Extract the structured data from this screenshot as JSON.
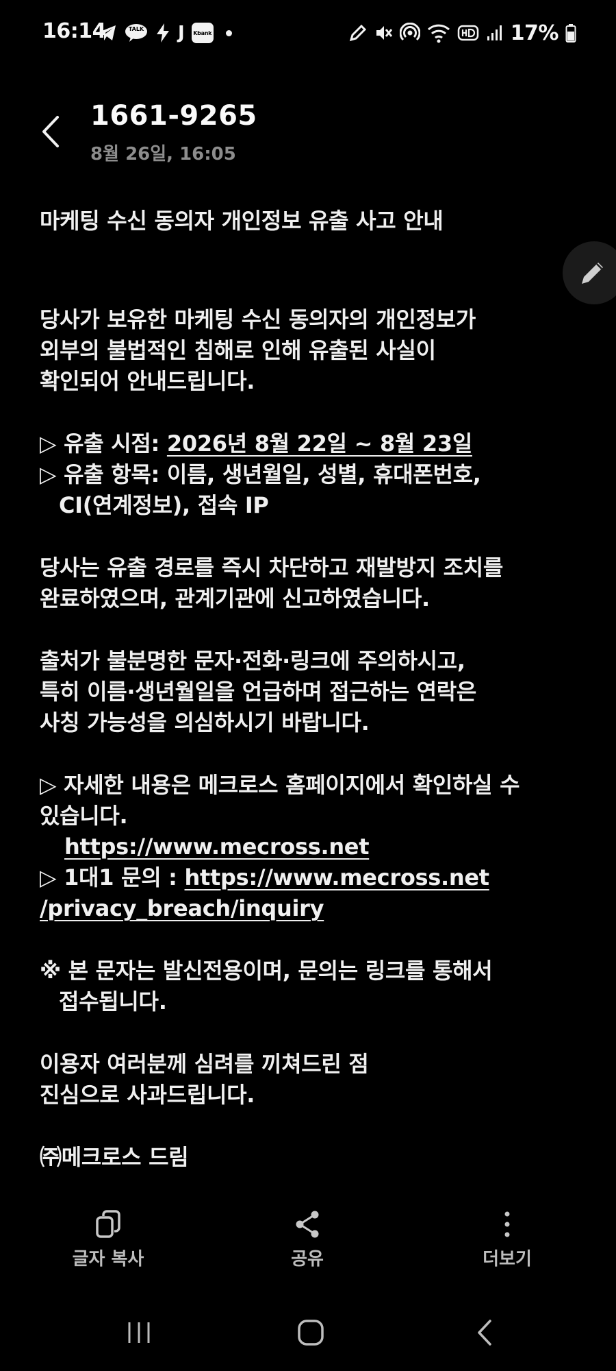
{
  "status_bar": {
    "time": "16:14",
    "talk_label": "TALK",
    "j_label": "J",
    "kbank_label": "Kbank",
    "battery_percent": "17%",
    "icons_left": [
      "telegram-icon",
      "kakaotalk-icon",
      "bolt-icon",
      "j-icon",
      "kbank-icon",
      "dot-icon"
    ],
    "icons_right": [
      "pen-icon",
      "mute-icon",
      "hotspot-icon",
      "wifi-icon",
      "hd-icon",
      "signal-icon",
      "battery-icon"
    ]
  },
  "header": {
    "sender": "1661-9265",
    "datetime": "8월 26일, 16:05"
  },
  "message": {
    "title": "마케팅 수신 동의자 개인정보 유출 사고 안내",
    "para1": [
      "당사가 보유한 마케팅 수신 동의자의 개인정보가",
      "외부의 불법적인 침해로 인해 유출된 사실이",
      "확인되어 안내드립니다."
    ],
    "leak_time_prefix": "▷ 유출 시점: ",
    "leak_time_value": "2026년 8월 22일 ~ 8월 23일",
    "leak_items_line1": "▷ 유출 항목: 이름, 생년월일, 성별, 휴대폰번호,",
    "leak_items_line2": "CI(연계정보), 접속 IP",
    "para2": [
      "당사는 유출 경로를 즉시 차단하고 재발방지 조치를",
      "완료하였으며, 관계기관에 신고하였습니다."
    ],
    "para3": [
      "출처가 불분명한 문자·전화·링크에 주의하시고,",
      "특히 이름·생년월일을 언급하며 접근하는 연락은",
      "사칭 가능성을 의심하시기 바랍니다."
    ],
    "details_line1": "▷ 자세한 내용은 메크로스 홈페이지에서 확인하실 수",
    "details_line2": "있습니다.",
    "homepage_link": "https://www.mecross.net",
    "inquiry_prefix": "▷ 1대1 문의 : ",
    "inquiry_link_part1": "https://www.mecross.net",
    "inquiry_link_part2": "/privacy_breach/inquiry",
    "notice_line1": "※ 본 문자는 발신전용이며, 문의는 링크를 통해서",
    "notice_line2": "접수됩니다.",
    "apology": [
      "이용자 여러분께 심려를 끼쳐드린 점",
      "진심으로 사과드립니다."
    ],
    "signature": "㈜메크로스 드림"
  },
  "actions": {
    "copy_label": "글자 복사",
    "share_label": "공유",
    "more_label": "더보기"
  },
  "colors": {
    "background": "#000000",
    "text": "#f0f0f0",
    "secondary_text": "#8d8d8d",
    "action_label": "#bdbdbd"
  }
}
